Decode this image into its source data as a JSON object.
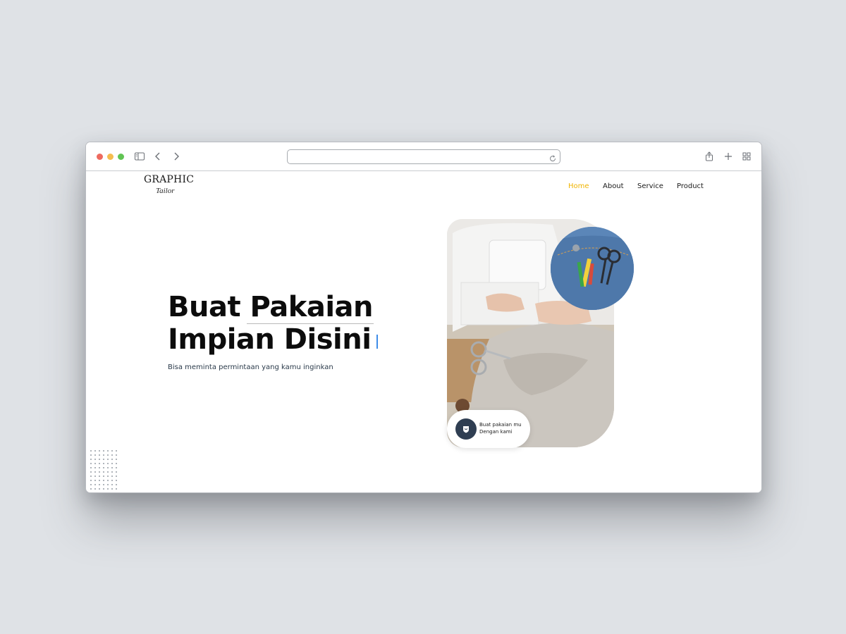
{
  "browser": {
    "url": "",
    "controls": {
      "sidebar_icon": "sidebar-icon",
      "back_icon": "chevron-left-icon",
      "forward_icon": "chevron-right-icon",
      "reload_icon": "reload-icon",
      "share_icon": "share-icon",
      "new_tab_icon": "plus-icon",
      "tabs_icon": "grid-icon"
    }
  },
  "logo": {
    "line1": "GRAPHIC",
    "line2": "Tailor"
  },
  "nav": {
    "items": [
      {
        "label": "Home",
        "active": true
      },
      {
        "label": "About",
        "active": false
      },
      {
        "label": "Service",
        "active": false
      },
      {
        "label": "Product",
        "active": false
      }
    ]
  },
  "hero": {
    "headline_line1": "Buat Pakaian",
    "headline_line2": "Impian Disini",
    "subtitle": "Bisa meminta permintaan yang kamu inginkan"
  },
  "badge": {
    "line1": "Buat pakaian mu",
    "line2": "Dengan kami",
    "icon": "shield-icon"
  },
  "colors": {
    "accent": "#f0b400",
    "cursor": "#3f8de8",
    "badge_icon_bg": "#2f3e52"
  }
}
